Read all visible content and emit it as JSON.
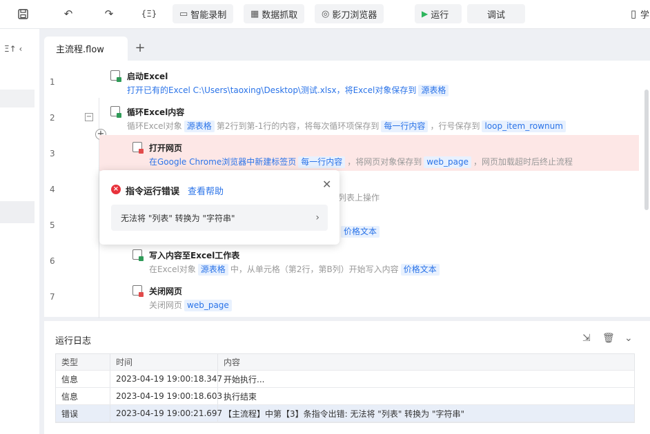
{
  "toolbar": {
    "save_icon": "save-icon",
    "undo_icon": "undo-icon",
    "redo_icon": "redo-icon",
    "code_label": "{Ξ}",
    "record_label": "智能录制",
    "grab_label": "数据抓取",
    "browser_label": "影刀浏览器",
    "run_label": "运行",
    "debug_label": "调试",
    "learn_label": "学"
  },
  "sidebar": {
    "control_label": "Ξ↑ ‹"
  },
  "editor": {
    "tab_label": "主流程.flow",
    "add_tab": "+",
    "steps": [
      {
        "line": "1",
        "title": "启动Excel",
        "desc_prefix": "打开已有的Excel C:\\Users\\taoxing\\Desktop\\测试.xlsx，将Excel对象保存到",
        "tag1": "源表格"
      },
      {
        "line": "2",
        "title": "循环Excel内容",
        "d1": "循环Excel对象",
        "tag1": "源表格",
        "d2": "第2行到第-1行的内容，将每次循环项保存到",
        "tag2": "每一行内容",
        "d3": "，行号保存到",
        "tag3": "loop_item_rownum"
      },
      {
        "line": "3",
        "title": "打开网页",
        "d1": "在Google Chrome浏览器中新建标签页",
        "tag1": "每一行内容",
        "d2": "，将网页对象保存到",
        "tag2": "web_page",
        "d3": "，网页加载超时后终止流程"
      },
      {
        "line": "4",
        "d_tail": "列表上操作"
      },
      {
        "line": "5",
        "tag_tail": "价格文本"
      },
      {
        "line": "6",
        "title": "写入内容至Excel工作表",
        "d1": "在Excel对象",
        "tag1": "源表格",
        "d2": "中，从单元格（第2行，第B列）开始写入内容",
        "tag2": "价格文本"
      },
      {
        "line": "7",
        "title": "关闭网页",
        "d1": "关闭网页",
        "tag1": "web_page"
      }
    ]
  },
  "error_popup": {
    "title": "指令运行错误",
    "help_link": "查看帮助",
    "message": "无法将 \"列表\" 转换为 \"字符串\""
  },
  "log": {
    "title": "运行日志",
    "columns": [
      "类型",
      "时间",
      "内容"
    ],
    "rows": [
      {
        "type": "信息",
        "time": "2023-04-19 19:00:18.347",
        "content": "开始执行..."
      },
      {
        "type": "信息",
        "time": "2023-04-19 19:00:18.603",
        "content": "执行结束"
      },
      {
        "type": "错误",
        "time": "2023-04-19 19:00:21.697",
        "content": "【主流程】中第【3】条指令出错: 无法将 \"列表\" 转换为 \"字符串\""
      }
    ]
  }
}
